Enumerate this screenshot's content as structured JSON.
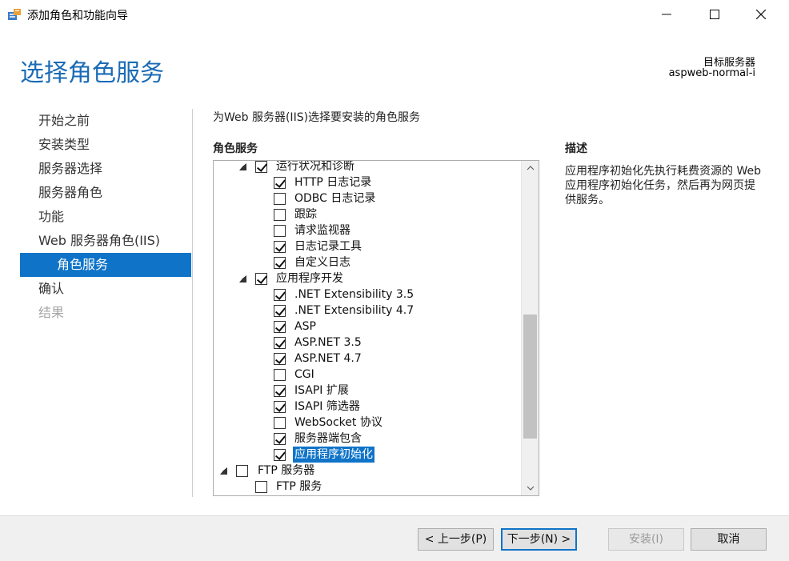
{
  "window": {
    "title": "添加角色和功能向导",
    "app_icon": "server-manager-icon"
  },
  "header": {
    "page_title": "选择角色服务",
    "target_label": "目标服务器",
    "target_name": "aspweb-normal-i"
  },
  "nav": {
    "items": [
      {
        "label": "开始之前",
        "state": "normal"
      },
      {
        "label": "安装类型",
        "state": "normal"
      },
      {
        "label": "服务器选择",
        "state": "normal"
      },
      {
        "label": "服务器角色",
        "state": "normal"
      },
      {
        "label": "功能",
        "state": "normal"
      },
      {
        "label": "Web 服务器角色(IIS)",
        "state": "normal"
      },
      {
        "label": "角色服务",
        "state": "active"
      },
      {
        "label": "确认",
        "state": "normal"
      },
      {
        "label": "结果",
        "state": "disabled"
      }
    ]
  },
  "main": {
    "instruction": "为Web 服务器(IIS)选择要安装的角色服务",
    "list_header": "角色服务",
    "tree": [
      {
        "label": "运行状况和诊断",
        "level": 1,
        "checked": true,
        "expanded": true
      },
      {
        "label": "HTTP 日志记录",
        "level": 2,
        "checked": true
      },
      {
        "label": "ODBC 日志记录",
        "level": 2,
        "checked": false
      },
      {
        "label": "跟踪",
        "level": 2,
        "checked": false
      },
      {
        "label": "请求监视器",
        "level": 2,
        "checked": false
      },
      {
        "label": "日志记录工具",
        "level": 2,
        "checked": true
      },
      {
        "label": "自定义日志",
        "level": 2,
        "checked": true
      },
      {
        "label": "应用程序开发",
        "level": 1,
        "checked": true,
        "expanded": true
      },
      {
        "label": ".NET Extensibility 3.5",
        "level": 2,
        "checked": true
      },
      {
        "label": ".NET Extensibility 4.7",
        "level": 2,
        "checked": true
      },
      {
        "label": "ASP",
        "level": 2,
        "checked": true
      },
      {
        "label": "ASP.NET 3.5",
        "level": 2,
        "checked": true
      },
      {
        "label": "ASP.NET 4.7",
        "level": 2,
        "checked": true
      },
      {
        "label": "CGI",
        "level": 2,
        "checked": false
      },
      {
        "label": "ISAPI 扩展",
        "level": 2,
        "checked": true
      },
      {
        "label": "ISAPI 筛选器",
        "level": 2,
        "checked": true
      },
      {
        "label": "WebSocket 协议",
        "level": 2,
        "checked": false
      },
      {
        "label": "服务器端包含",
        "level": 2,
        "checked": true
      },
      {
        "label": "应用程序初始化",
        "level": 2,
        "checked": true,
        "selected": true
      },
      {
        "label": "FTP 服务器",
        "level": 0,
        "checked": false,
        "expanded": true
      },
      {
        "label": "FTP 服务",
        "level": 1,
        "checked": false
      }
    ],
    "scroll_position": 0.48
  },
  "description": {
    "header": "描述",
    "text": "应用程序初始化先执行耗费资源的 Web 应用程序初始化任务，然后再为网页提供服务。"
  },
  "footer": {
    "prev_label": "< 上一步(P)",
    "next_label": "下一步(N) >",
    "install_label": "安装(I)",
    "cancel_label": "取消"
  },
  "colors": {
    "accent": "#0f74c8",
    "title": "#1a6bb5"
  }
}
